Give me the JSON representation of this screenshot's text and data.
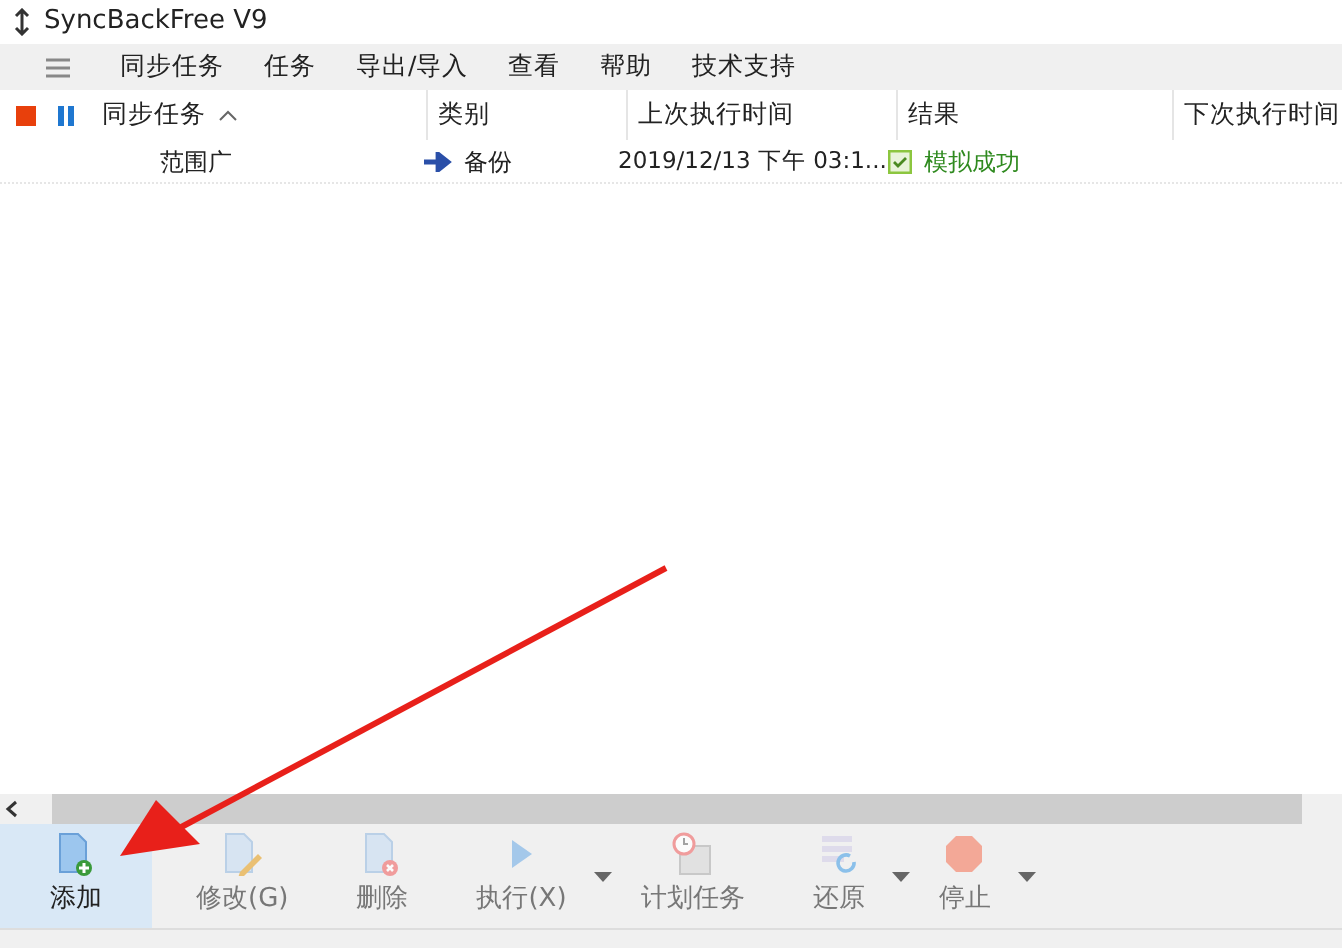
{
  "window": {
    "title": "SyncBackFree V9"
  },
  "menu": [
    "同步任务",
    "任务",
    "导出/导入",
    "查看",
    "帮助",
    "技术支持"
  ],
  "table": {
    "columns": [
      {
        "label": "同步任务",
        "sort_ascending": true
      },
      {
        "label": "类别"
      },
      {
        "label": "上次执行时间"
      },
      {
        "label": "结果"
      },
      {
        "label": "下次执行时间"
      }
    ],
    "rows": [
      {
        "name": "范围广",
        "type": "备份",
        "last_run": "2019/12/13 下午 03:1...",
        "result": "模拟成功",
        "result_ok": true,
        "selected": false
      }
    ]
  },
  "toolbar": [
    {
      "kind": "add",
      "label": "添加",
      "disabled": false,
      "selected": true,
      "dropdown": false
    },
    {
      "kind": "edit",
      "label": "修改(G)",
      "disabled": true,
      "selected": false,
      "dropdown": false
    },
    {
      "kind": "delete",
      "label": "删除",
      "disabled": true,
      "selected": false,
      "dropdown": false
    },
    {
      "kind": "run",
      "label": "执行(X)",
      "disabled": true,
      "selected": false,
      "dropdown": true
    },
    {
      "kind": "schedule",
      "label": "计划任务",
      "disabled": true,
      "selected": false,
      "dropdown": false
    },
    {
      "kind": "restore",
      "label": "还原",
      "disabled": true,
      "selected": false,
      "dropdown": true
    },
    {
      "kind": "stop",
      "label": "停止",
      "disabled": true,
      "selected": false,
      "dropdown": true
    }
  ]
}
